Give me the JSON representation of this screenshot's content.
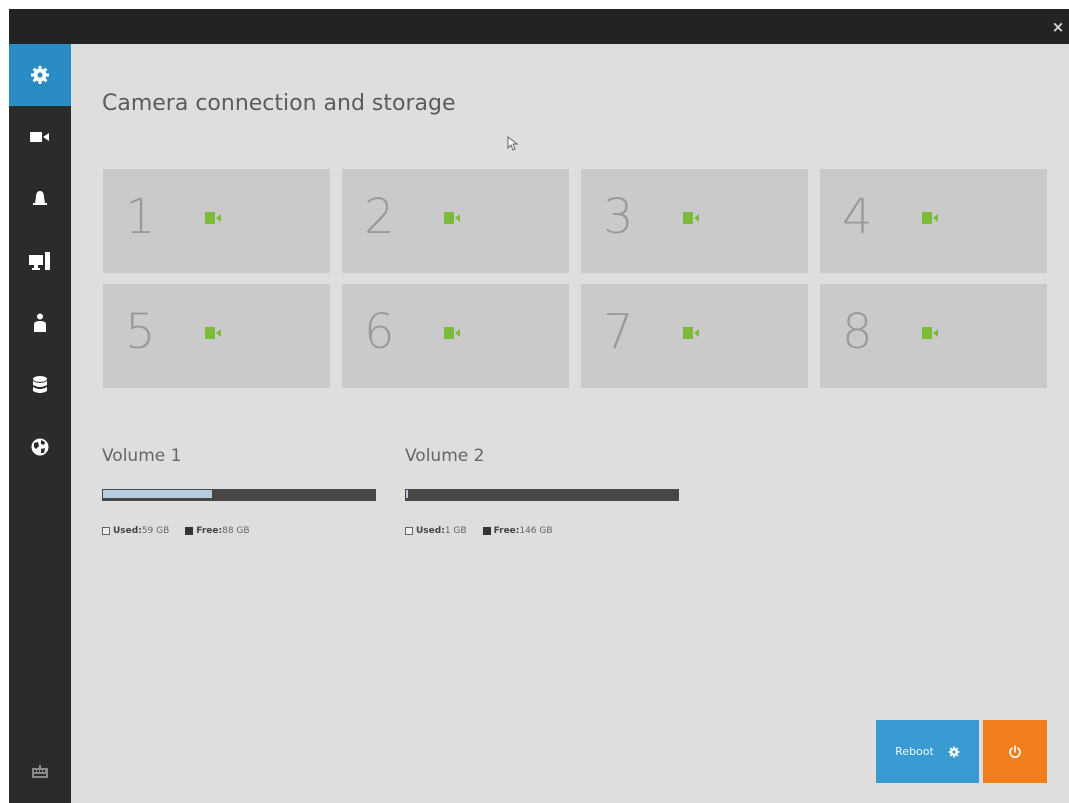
{
  "window": {
    "close_glyph": "×"
  },
  "sidebar": {
    "items": [
      {
        "icon": "gear-icon",
        "active": true
      },
      {
        "icon": "video-camera-icon",
        "active": false
      },
      {
        "icon": "bell-icon",
        "active": false
      },
      {
        "icon": "monitor-icon",
        "active": false
      },
      {
        "icon": "user-icon",
        "active": false
      },
      {
        "icon": "database-icon",
        "active": false
      },
      {
        "icon": "globe-icon",
        "active": false
      },
      {
        "icon": "keyboard-icon",
        "active": false
      }
    ],
    "active_color": "#2a8cc4"
  },
  "main": {
    "title": "Camera connection and storage",
    "cameras": [
      {
        "number": "1",
        "icon": "camera-connected-icon"
      },
      {
        "number": "2",
        "icon": "camera-connected-icon"
      },
      {
        "number": "3",
        "icon": "camera-connected-icon"
      },
      {
        "number": "4",
        "icon": "camera-connected-icon"
      },
      {
        "number": "5",
        "icon": "camera-connected-icon"
      },
      {
        "number": "6",
        "icon": "camera-connected-icon"
      },
      {
        "number": "7",
        "icon": "camera-connected-icon"
      },
      {
        "number": "8",
        "icon": "camera-connected-icon"
      }
    ],
    "camera_icon_color": "#7cba3a",
    "volumes": [
      {
        "name": "Volume 1",
        "used_label": "Used:",
        "used_value": "59 GB",
        "free_label": "Free:",
        "free_value": "88 GB",
        "used_fraction": 0.4
      },
      {
        "name": "Volume 2",
        "used_label": "Used:",
        "used_value": "1 GB",
        "free_label": "Free:",
        "free_value": "146 GB",
        "used_fraction": 0.0068
      }
    ],
    "buttons": {
      "reboot_label": "Reboot",
      "reboot_color": "#3a9bd2",
      "power_color": "#f07e1b"
    }
  }
}
